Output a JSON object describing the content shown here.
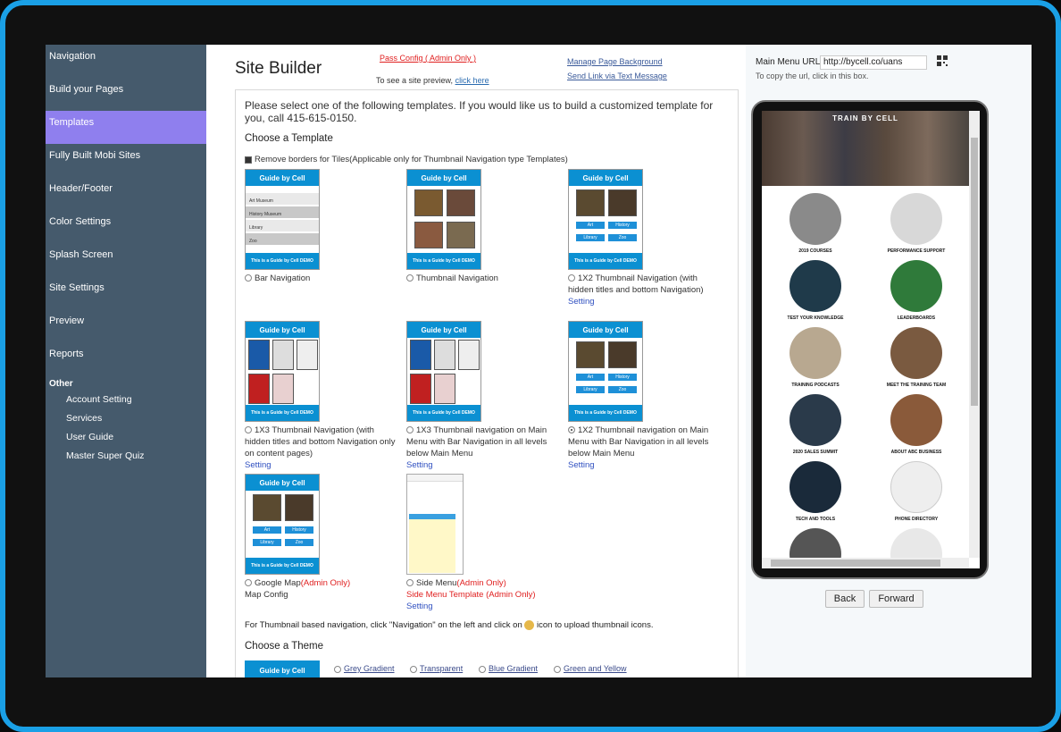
{
  "sidebar": {
    "items": [
      "Navigation",
      "Build your Pages",
      "Templates",
      "Fully Built Mobi Sites",
      "Header/Footer",
      "Color Settings",
      "Splash Screen",
      "Site Settings",
      "Preview",
      "Reports"
    ],
    "active": "Templates",
    "other_heading": "Other",
    "other_items": [
      "Account Setting",
      "Services",
      "User Guide",
      "Master Super Quiz"
    ]
  },
  "header": {
    "title": "Site Builder",
    "pass_config": "Pass Config ( Admin Only )",
    "preview_text": "To see a site preview,",
    "preview_link": "click here",
    "manage_bg": "Manage Page Background",
    "send_link": "Send Link via Text Message"
  },
  "panel": {
    "intro": "Please select one of the following templates. If you would like us to build a customized template for you, call 415-615-0150.",
    "choose_template": "Choose a Template",
    "remove_borders": "Remove borders for Tiles(Applicable only for Thumbnail Navigation type Templates)",
    "brand": "Guide by Cell",
    "demo_footer": "This is a Guide by Cell DEMO",
    "templates": [
      {
        "label": "Bar Navigation",
        "setting": ""
      },
      {
        "label": "Thumbnail Navigation",
        "setting": ""
      },
      {
        "label": "1X2 Thumbnail Navigation (with hidden titles and bottom Navigation)",
        "setting": "Setting"
      },
      {
        "label": "1X3 Thumbnail Navigation (with hidden titles and bottom Navigation only on content pages)",
        "setting": "Setting"
      },
      {
        "label": "1X3 Thumbnail navigation on Main Menu with Bar Navigation in all levels below Main Menu",
        "setting": "Setting"
      },
      {
        "label": "1X2 Thumbnail navigation on Main Menu with Bar Navigation in all levels below Main Menu",
        "setting": "Setting"
      }
    ],
    "google_map": "Google Map",
    "admin_only": "(Admin Only)",
    "map_config": "Map Config",
    "side_menu": "Side Menu",
    "side_menu_template": "Side Menu Template (Admin Only)",
    "side_menu_setting": "Setting",
    "bar_items": [
      "Art Museum",
      "History Museum",
      "Library",
      "Zoo"
    ],
    "pill_labels": [
      "Art",
      "History",
      "Library",
      "Zoo"
    ],
    "icon_note_1": "For Thumbnail based navigation, click \"Navigation\" on the left and click on",
    "icon_note_2": "icon to upload thumbnail icons.",
    "choose_theme": "Choose a Theme",
    "themes": [
      "Grey Gradient",
      "Transparent",
      "Blue Gradient",
      "Green and Yellow"
    ]
  },
  "right": {
    "url_label": "Main Menu URL:",
    "url_value": "http://bycell.co/uans",
    "hint": "To copy the url, click in this box.",
    "banner": "TRAIN BY CELL",
    "tiles": [
      "2019 COURSES",
      "PERFORMANCE SUPPORT",
      "TEST YOUR KNOWLEDGE",
      "LEADERBOARDS",
      "TRAINING PODCASTS",
      "MEET THE TRAINING TEAM",
      "2020 SALES SUMMIT",
      "ABOUT ABC BUSINESS",
      "TECH AND TOOLS",
      "PHONE DIRECTORY"
    ],
    "back": "Back",
    "forward": "Forward"
  }
}
